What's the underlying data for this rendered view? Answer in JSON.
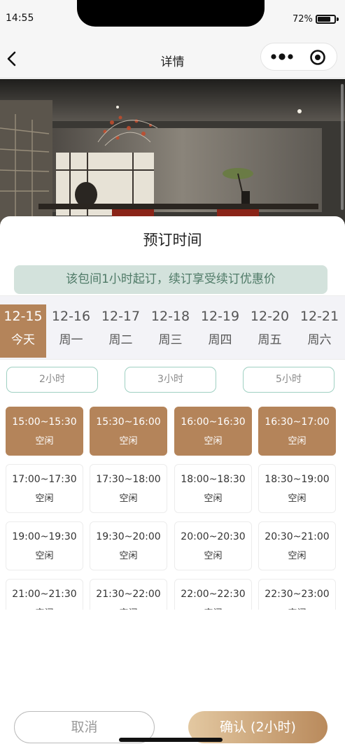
{
  "status_bar": {
    "time": "14:55",
    "battery_percent": "72%"
  },
  "nav": {
    "title": "详情"
  },
  "sheet": {
    "title": "预订时间",
    "notice": "该包间1小时起订，续订享受续订优惠价"
  },
  "dates": [
    {
      "date": "12-15",
      "weekday": "今天",
      "active": true
    },
    {
      "date": "12-16",
      "weekday": "周一"
    },
    {
      "date": "12-17",
      "weekday": "周二"
    },
    {
      "date": "12-18",
      "weekday": "周三"
    },
    {
      "date": "12-19",
      "weekday": "周四"
    },
    {
      "date": "12-20",
      "weekday": "周五"
    },
    {
      "date": "12-21",
      "weekday": "周六"
    }
  ],
  "durations": [
    "2小时",
    "3小时",
    "5小时"
  ],
  "slots": [
    {
      "time": "15:00~15:30",
      "status": "空闲",
      "selected": true
    },
    {
      "time": "15:30~16:00",
      "status": "空闲",
      "selected": true
    },
    {
      "time": "16:00~16:30",
      "status": "空闲",
      "selected": true
    },
    {
      "time": "16:30~17:00",
      "status": "空闲",
      "selected": true
    },
    {
      "time": "17:00~17:30",
      "status": "空闲"
    },
    {
      "time": "17:30~18:00",
      "status": "空闲"
    },
    {
      "time": "18:00~18:30",
      "status": "空闲"
    },
    {
      "time": "18:30~19:00",
      "status": "空闲"
    },
    {
      "time": "19:00~19:30",
      "status": "空闲"
    },
    {
      "time": "19:30~20:00",
      "status": "空闲"
    },
    {
      "time": "20:00~20:30",
      "status": "空闲"
    },
    {
      "time": "20:30~21:00",
      "status": "空闲"
    },
    {
      "time": "21:00~21:30",
      "status": "空闲"
    },
    {
      "time": "21:30~22:00",
      "status": "空闲"
    },
    {
      "time": "22:00~22:30",
      "status": "空闲"
    },
    {
      "time": "22:30~23:00",
      "status": "空闲"
    }
  ],
  "actions": {
    "cancel_label": "取消",
    "confirm_label": "确认 (2小时)"
  },
  "colors": {
    "accent": "#b4845a",
    "notice_bg": "#d3e2dc",
    "notice_text": "#4f7a67",
    "duration_border": "#9fd0c2"
  },
  "icons": {
    "back": "chevron-left-icon",
    "more": "more-dots-icon",
    "close": "capsule-close-icon"
  }
}
